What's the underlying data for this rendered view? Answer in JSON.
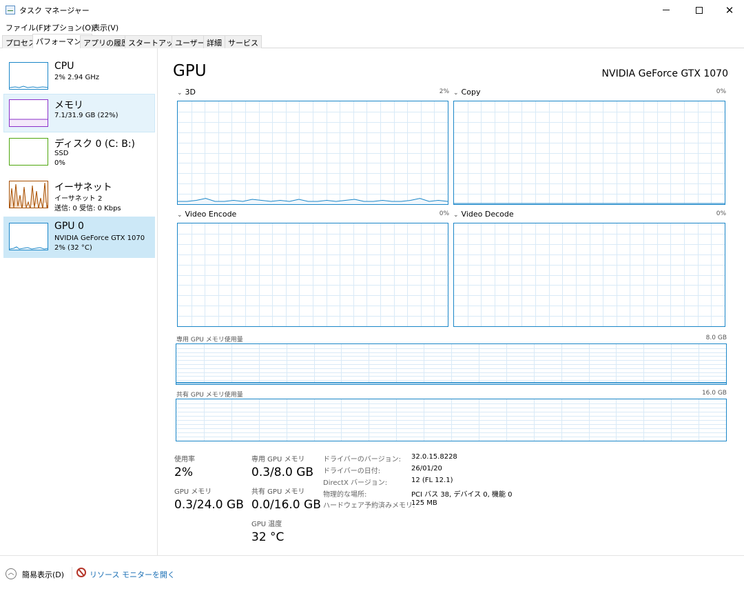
{
  "window": {
    "title": "タスク マネージャー",
    "minimize_glyph": "minimize",
    "maximize_glyph": "maximize",
    "close_glyph": "✕"
  },
  "menu": [
    {
      "label": "ファイル(F)"
    },
    {
      "label": "オプション(O)"
    },
    {
      "label": "表示(V)"
    }
  ],
  "tabs": [
    {
      "label": "プロセス",
      "active": false
    },
    {
      "label": "パフォーマンス",
      "active": true
    },
    {
      "label": "アプリの履歴",
      "active": false
    },
    {
      "label": "スタートアップ",
      "active": false
    },
    {
      "label": "ユーザー",
      "active": false
    },
    {
      "label": "詳細",
      "active": false
    },
    {
      "label": "サービス",
      "active": false
    }
  ],
  "sidebar": {
    "items": [
      {
        "name": "CPU",
        "line1": "2%  2.94 GHz",
        "line2": "",
        "color": "#1a86c8"
      },
      {
        "name": "メモリ",
        "line1": "7.1/31.9 GB (22%)",
        "line2": "",
        "color": "#8b2fc9"
      },
      {
        "name": "ディスク 0 (C: B:)",
        "line1": "SSD",
        "line2": "0%",
        "color": "#4da60c"
      },
      {
        "name": "イーサネット",
        "line1": "イーサネット 2",
        "line2": "送信: 0 受信: 0 Kbps",
        "color": "#a74f01"
      },
      {
        "name": "GPU 0",
        "line1": "NVIDIA GeForce GTX 1070",
        "line2": "2%  (32 °C)",
        "color": "#1a86c8"
      }
    ]
  },
  "main": {
    "title": "GPU",
    "model": "NVIDIA GeForce GTX 1070",
    "engines": [
      {
        "label": "3D",
        "percent": "2%",
        "usage": [
          2,
          2,
          3,
          5,
          2,
          2,
          3,
          2,
          4,
          3,
          2,
          3,
          2,
          4,
          2,
          2,
          3,
          2,
          3,
          4,
          2,
          2,
          3,
          2,
          2,
          3,
          5,
          2,
          3,
          2
        ]
      },
      {
        "label": "Copy",
        "percent": "0%",
        "usage": [
          0,
          0,
          0,
          0,
          0,
          0,
          0,
          0,
          0,
          0,
          0,
          0,
          0,
          0,
          0,
          0,
          0,
          0,
          0,
          0,
          0,
          0,
          0,
          0,
          0,
          0,
          0,
          0,
          0,
          0
        ]
      },
      {
        "label": "Video Encode",
        "percent": "0%",
        "usage": []
      },
      {
        "label": "Video Decode",
        "percent": "0%",
        "usage": []
      }
    ],
    "dedicated_label": "専用 GPU メモリ使用量",
    "dedicated_max": "8.0 GB",
    "dedicated_used_fraction": 0.0375,
    "shared_label": "共有 GPU メモリ使用量",
    "shared_max": "16.0 GB",
    "shared_used_fraction": 0.0,
    "stats": {
      "utilization_label": "使用率",
      "utilization_value": "2%",
      "gpu_memory_label": "GPU メモリ",
      "gpu_memory_value": "0.3/24.0 GB",
      "dedicated_label": "専用 GPU メモリ",
      "dedicated_value": "0.3/8.0 GB",
      "shared_label": "共有 GPU メモリ",
      "shared_value": "0.0/16.0 GB",
      "temp_label": "GPU 温度",
      "temp_value": "32 °C"
    },
    "info": [
      {
        "label": "ドライバーのバージョン:",
        "value": "32.0.15.8228"
      },
      {
        "label": "ドライバーの日付:",
        "value": "26/01/20"
      },
      {
        "label": "DirectX バージョン:",
        "value": "12 (FL 12.1)"
      },
      {
        "label": "物理的な場所:",
        "value": "PCI バス 38, デバイス 0, 機能 0"
      },
      {
        "label": "ハードウェア予約済みメモリ:",
        "value": "125 MB"
      }
    ]
  },
  "footer": {
    "fewer_details": "簡易表示(D)",
    "resource_monitor": "リソース モニターを開く"
  }
}
